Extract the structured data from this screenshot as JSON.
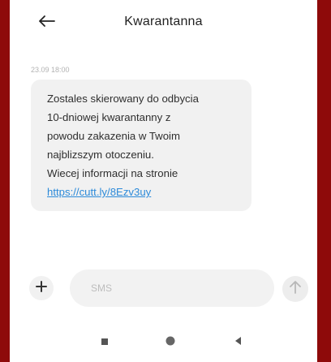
{
  "header": {
    "title": "Kwarantanna"
  },
  "message": {
    "timestamp": "23.09 18:00",
    "lines": [
      "Zostales skierowany do odbycia",
      "10-dniowej kwarantanny z",
      "powodu zakazenia w Twoim",
      "najblizszym otoczeniu.",
      "Wiecej informacji na stronie"
    ],
    "link": "https://cutt.ly/8Ezv3uy"
  },
  "composer": {
    "placeholder": "SMS"
  },
  "icons": {
    "back": "arrow-left-icon",
    "plus": "plus-icon",
    "send": "arrow-up-icon",
    "nav_recents": "square-icon",
    "nav_home": "circle-icon",
    "nav_back": "triangle-left-icon"
  },
  "colors": {
    "frame": "#8e0a0a",
    "bubble": "#f1f1f1",
    "link": "#2c8ad9",
    "text": "#2f2f2f"
  }
}
